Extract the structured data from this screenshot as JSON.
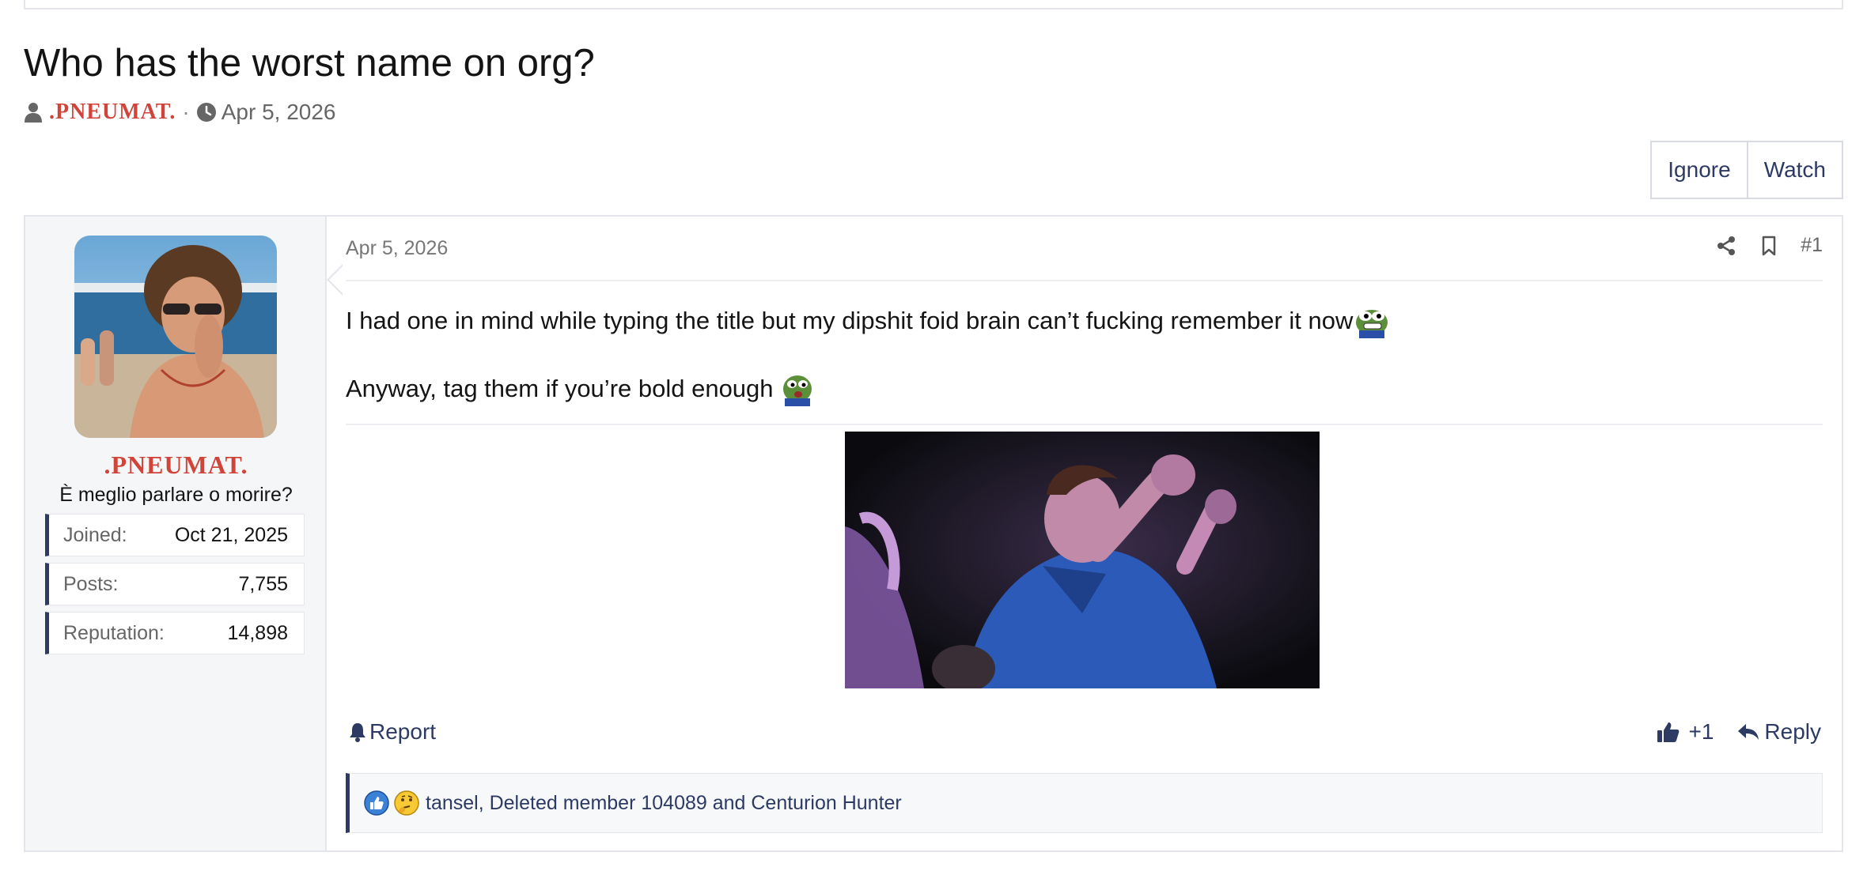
{
  "thread": {
    "title": "Who has the worst name on org?",
    "author": ".PNEUMAT.",
    "separator": "·",
    "date": "Apr 5, 2026"
  },
  "thread_actions": {
    "ignore_label": "Ignore",
    "watch_label": "Watch"
  },
  "user": {
    "name": ".PNEUMAT.",
    "title": "È meglio parlare o morire?",
    "stats": [
      {
        "label": "Joined:",
        "value": "Oct 21, 2025"
      },
      {
        "label": "Posts:",
        "value": "7,755"
      },
      {
        "label": "Reputation:",
        "value": "14,898"
      }
    ]
  },
  "post": {
    "date": "Apr 5, 2026",
    "number": "#1",
    "line1": "I had one in mind while typing the title but my dipshit foid brain can’t fucking remember it now",
    "line2": "Anyway, tag them if you’re bold enough",
    "report_label": "Report",
    "like_label": "+1",
    "reply_label": "Reply",
    "reactions_text": "tansel, Deleted member 104089 and Centurion Hunter"
  },
  "colors": {
    "accent": "#2c3a64",
    "username": "#d1443a",
    "border": "#e4e6eb",
    "user_bg": "#f5f6f8"
  },
  "icons": [
    "user-icon",
    "clock-icon",
    "share-icon",
    "bookmark-icon",
    "bell-icon",
    "thumbs-up-icon",
    "reply-icon",
    "like-reaction-icon",
    "thinking-reaction-icon",
    "pepe-grin-emoji",
    "pepe-emoji"
  ]
}
